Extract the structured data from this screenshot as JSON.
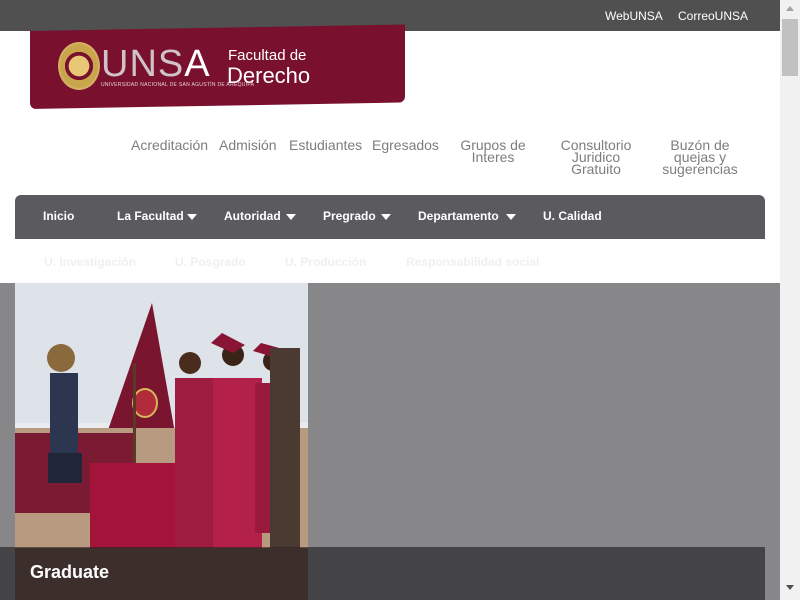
{
  "colors": {
    "topbar": "#505050",
    "brand": "#79102e",
    "menu": "#5b5a5f",
    "hero": "#878689"
  },
  "topbar": {
    "links": [
      "WebUNSA",
      "CorreoUNSA"
    ]
  },
  "logo": {
    "mark": "UNS",
    "mark_last": "A",
    "subtitle": "UNIVERSIDAD NACIONAL DE SAN AGUSTÍN DE AREQUIPA",
    "faculty_line1": "Facultad de",
    "faculty_line2": "Derecho"
  },
  "secondary_nav": [
    {
      "label": "Acreditación"
    },
    {
      "label": "Admisión"
    },
    {
      "label": "Estudiantes"
    },
    {
      "label": "Egresados"
    },
    {
      "label": "Grupos de Interes"
    },
    {
      "label": "Consultorio Juridico Gratuito"
    },
    {
      "label": "Buzón de quejas y sugerencias"
    }
  ],
  "main_menu": [
    {
      "label": "Inicio",
      "dropdown": false
    },
    {
      "label": "La Facultad",
      "dropdown": true
    },
    {
      "label": "Autoridad",
      "dropdown": true
    },
    {
      "label": "Pregrado",
      "dropdown": true
    },
    {
      "label": "Departamento",
      "dropdown": true
    },
    {
      "label": "U. Calidad",
      "dropdown": false
    }
  ],
  "sub_menu": [
    {
      "label": "U. Investigación"
    },
    {
      "label": "U. Posgrado"
    },
    {
      "label": "U. Producción"
    },
    {
      "label": "Responsabilidad social"
    }
  ],
  "hero": {
    "caption": "Graduate"
  }
}
